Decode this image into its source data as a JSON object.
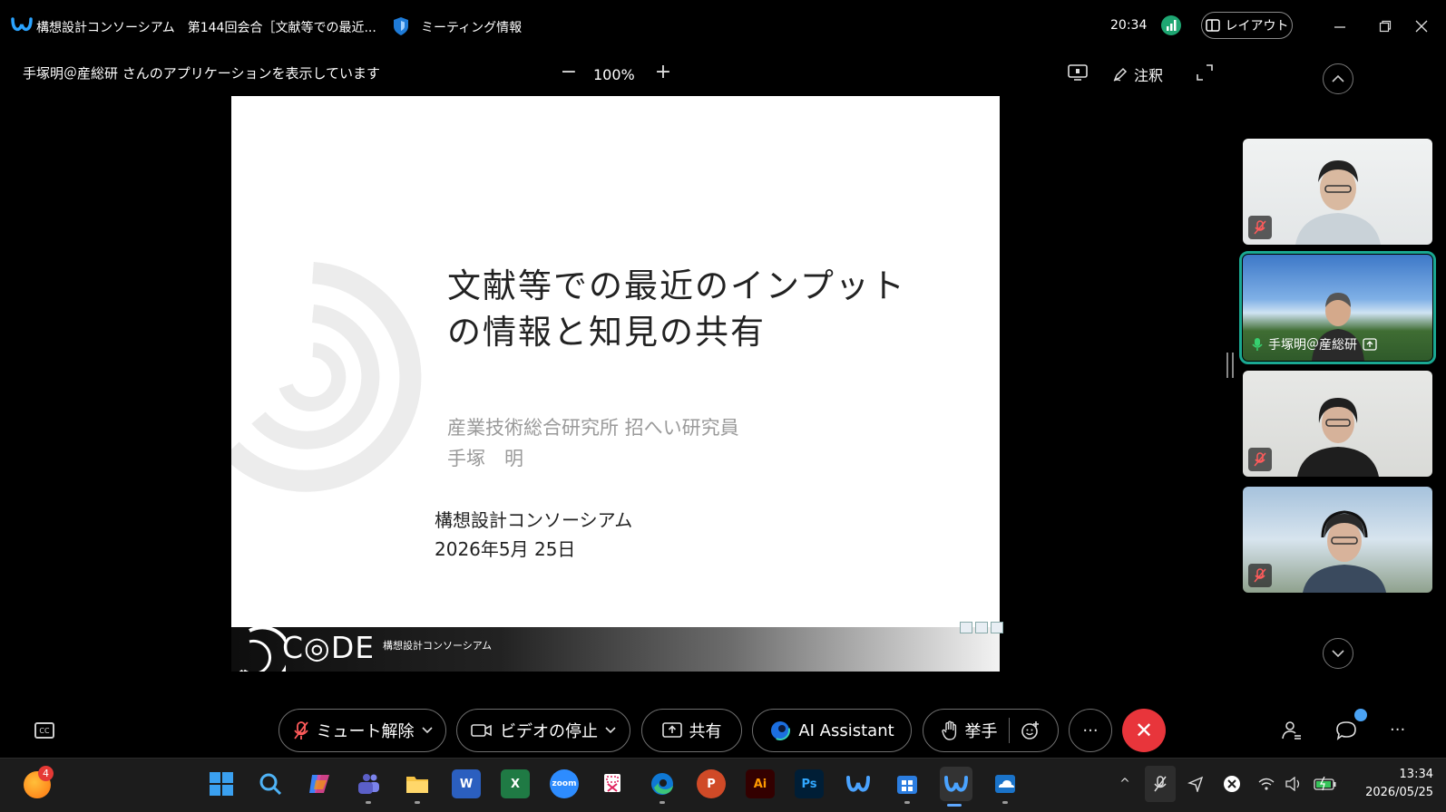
{
  "titlebar": {
    "title": "構想設計コンソーシアム　第144回会合［文献等での最近...",
    "meeting_info": "ミーティング情報",
    "clock": "20:34",
    "layout_label": "レイアウト"
  },
  "share_toolbar": {
    "label": "手塚明＠産総研 さんのアプリケーションを表示しています",
    "zoom_minus": "−",
    "zoom_value": "100%",
    "zoom_plus": "+",
    "annotate_label": "注釈"
  },
  "slide": {
    "title": "文献等での最近のインプット\nの情報と知見の共有",
    "affiliation": "産業技術総合研究所 招へい研究員",
    "author": "手塚　明",
    "organization": "構想設計コンソーシアム",
    "date": "2026年5月 25日",
    "footer_logo": "C◎DE",
    "footer_sub": "構想設計コンソーシアム"
  },
  "participants": [
    {
      "muted": true,
      "active": false
    },
    {
      "name": "手塚明＠産総研",
      "muted": false,
      "active": true,
      "sharing": true
    },
    {
      "muted": true,
      "active": false
    },
    {
      "muted": true,
      "active": false
    }
  ],
  "controls": {
    "cc": "CC",
    "unmute": "ミュート解除",
    "stop_video": "ビデオの停止",
    "share": "共有",
    "ai_assistant": "AI Assistant",
    "raise_hand": "挙手",
    "more": "···",
    "leave": "✕",
    "overflow": "···"
  },
  "taskbar": {
    "weather_badge": "4",
    "apps": [
      "start",
      "search",
      "copilot",
      "teams",
      "file-explorer",
      "word",
      "excel",
      "zoom",
      "snipping-tool",
      "edge",
      "powerpoint",
      "illustrator",
      "photoshop",
      "webex",
      "store",
      "webex-active",
      "onedrive"
    ],
    "zoom_label": "zoom",
    "word_label": "W",
    "excel_label": "X",
    "ppt_label": "P",
    "ai_label": "Ai",
    "ps_label": "Ps",
    "tray_chevron": "^",
    "time": "13:34",
    "date": "2026/05/25"
  },
  "colors": {
    "accent_green": "#1aa892",
    "leave_red": "#e8353b",
    "signal_green": "#1ea672",
    "chat_dot": "#4aa3f5"
  }
}
